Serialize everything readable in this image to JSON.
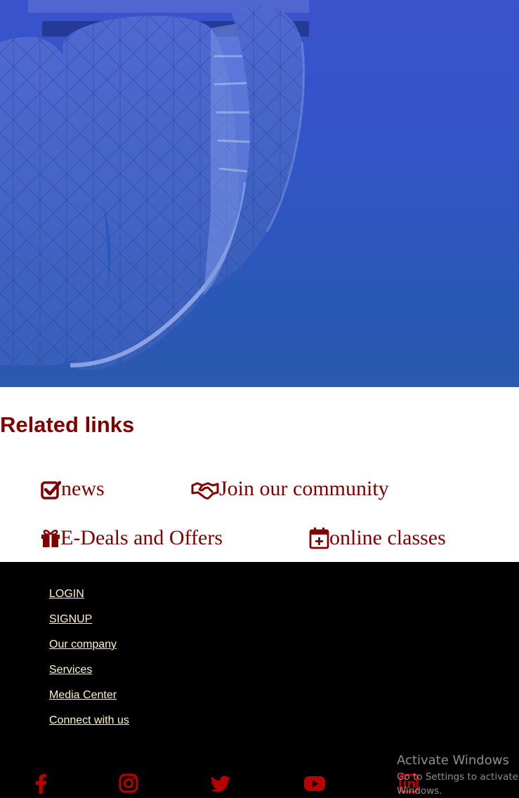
{
  "hero": {
    "image": "architecture-roof-shells-image"
  },
  "related": {
    "title": "Related links",
    "links": [
      {
        "label": "news",
        "icon": "check-square-icon"
      },
      {
        "label": "Join our community",
        "icon": "handshake-icon"
      },
      {
        "label": "E-Deals and Offers",
        "icon": "gift-icon"
      },
      {
        "label": "online classes",
        "icon": "calendar-plus-icon"
      }
    ],
    "color": "#800000"
  },
  "footer": {
    "links": [
      "LOGIN",
      "SIGNUP",
      "Our company",
      "Services",
      "Media Center",
      "Connect with us"
    ],
    "link_color": "#fff3c4",
    "background": "#000000",
    "social": [
      "facebook-icon",
      "instagram-icon",
      "twitter-icon",
      "youtube-icon",
      "linkedin-icon"
    ],
    "social_color": "#b80000"
  },
  "watermark": {
    "title": "Activate Windows",
    "subtitle": "Go to Settings to activate Windows."
  }
}
